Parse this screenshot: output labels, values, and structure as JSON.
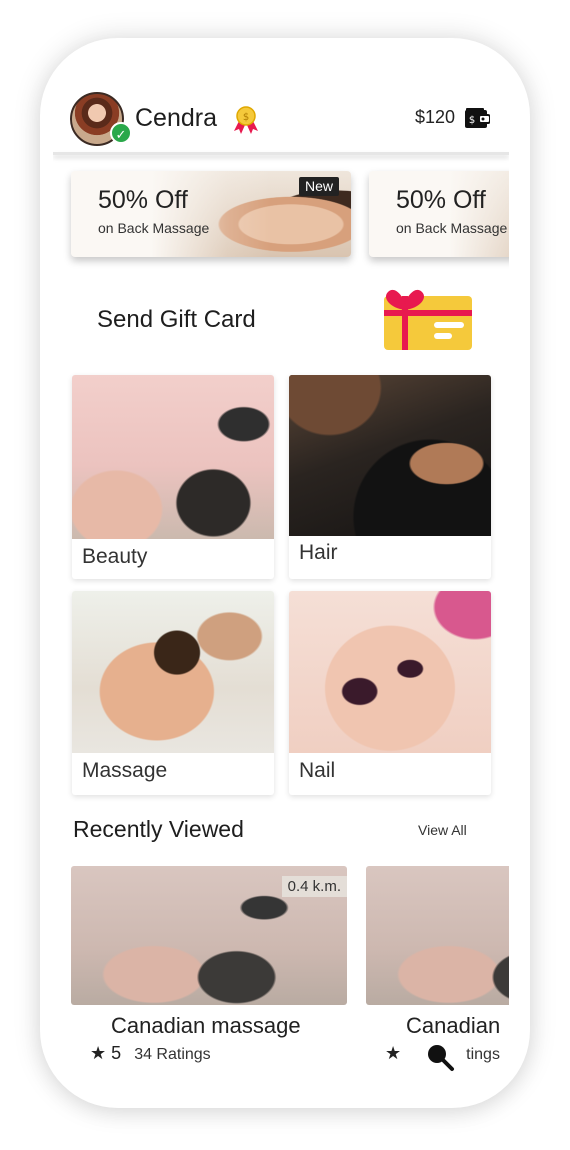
{
  "header": {
    "username": "Cendra",
    "balance": "$120",
    "medal_icon": "medal-icon",
    "wallet_icon": "wallet-icon",
    "verified_icon": "verified-check-icon"
  },
  "offers": [
    {
      "title": "50% Off",
      "subtitle": "on Back Massage",
      "badge": "New"
    },
    {
      "title": "50% Off",
      "subtitle": "on Back Massage",
      "badge": ""
    }
  ],
  "gift": {
    "title": "Send Gift Card",
    "icon": "gift-card-icon"
  },
  "categories": [
    {
      "label": "Beauty"
    },
    {
      "label": "Hair"
    },
    {
      "label": "Massage"
    },
    {
      "label": "Nail"
    }
  ],
  "recently_viewed": {
    "title": "Recently Viewed",
    "view_all": "View All",
    "items": [
      {
        "name": "Canadian massage",
        "rating": "5",
        "ratings_count": "34 Ratings",
        "distance": "0.4 k.m."
      },
      {
        "name": "Canadian",
        "rating": "",
        "ratings_count": "tings",
        "distance": ""
      }
    ]
  },
  "colors": {
    "accent_red": "#e8194f",
    "gift_yellow": "#f5c93b",
    "verified_green": "#2aa84a"
  },
  "icons": {
    "search": "search-icon",
    "star": "star-icon"
  }
}
